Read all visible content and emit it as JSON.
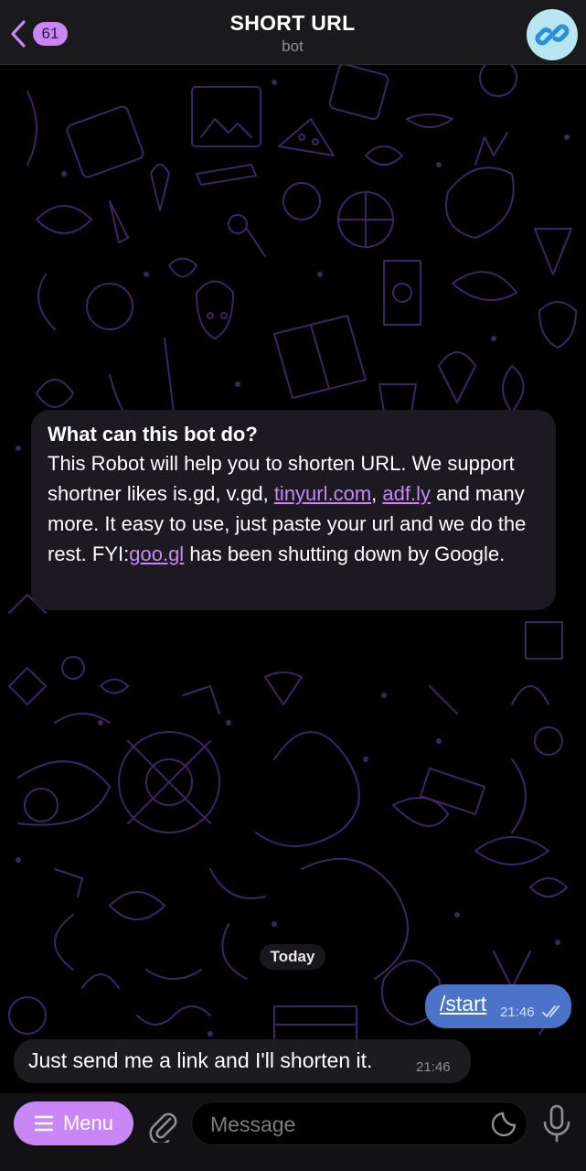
{
  "header": {
    "back_count": "61",
    "title": "SHORT URL",
    "subtitle": "bot",
    "avatar_icon": "link-icon"
  },
  "info_card": {
    "title": "What can this bot do?",
    "body_1": "This Robot will help you to shorten URL. We support shortner likes is.gd, v.gd, ",
    "link_1": "tinyurl.com",
    "body_2": ", ",
    "link_2": "adf.ly",
    "body_3": " and many more. It easy to use, just paste your url and we do the rest. FYI:",
    "link_3": "goo.gl",
    "body_4": " has been shutting down by Google."
  },
  "chat": {
    "date_label": "Today",
    "outgoing": {
      "text": "/start",
      "time": "21:46",
      "status": "read"
    },
    "incoming": {
      "text": "Just send me a link and I'll shorten it.",
      "time": "21:46"
    }
  },
  "composer": {
    "menu_label": "Menu",
    "placeholder": "Message"
  },
  "colors": {
    "accent": "#c987f5",
    "outgoing_bubble": "#4b73c7",
    "avatar_bg": "#b9e6f3",
    "doodle": "#3c2258"
  }
}
